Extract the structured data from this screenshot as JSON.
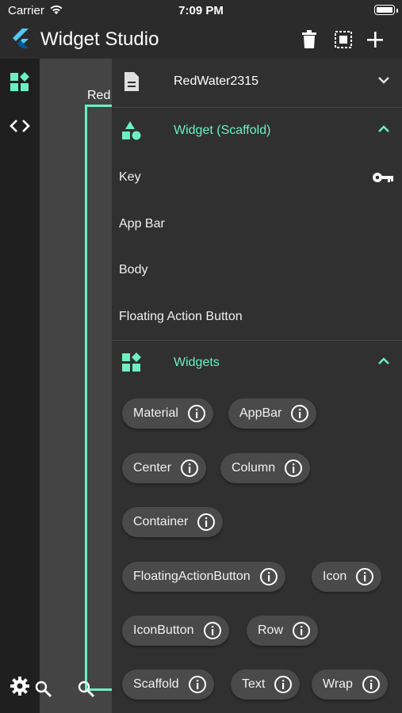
{
  "status": {
    "carrier": "Carrier",
    "time": "7:09 PM"
  },
  "app": {
    "title": "Widget Studio"
  },
  "colors": {
    "accent": "#6cf0c2",
    "panel": "#303030",
    "chip": "#4a4a4a",
    "rail": "#1f1f1f"
  },
  "canvas": {
    "fragment_text": "Red"
  },
  "panel": {
    "document": {
      "name": "RedWater2315",
      "icon": "document-icon"
    },
    "widget_section": {
      "label": "Widget (Scaffold)",
      "properties": [
        "Key",
        "App Bar",
        "Body",
        "Floating Action Button"
      ]
    },
    "widgets_section": {
      "label": "Widgets",
      "chips": [
        "Material",
        "AppBar",
        "Center",
        "Column",
        "Container",
        "FloatingActionButton",
        "Icon",
        "IconButton",
        "Row",
        "Scaffold",
        "Text",
        "Wrap"
      ]
    }
  }
}
